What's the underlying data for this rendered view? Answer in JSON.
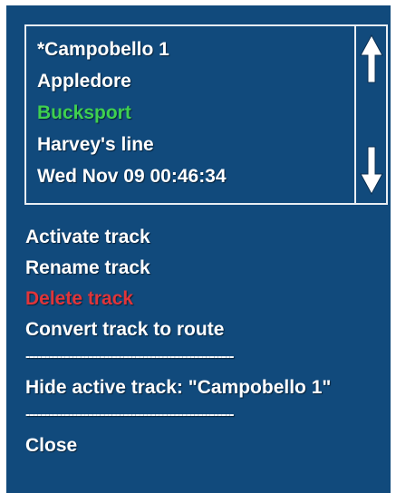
{
  "colors": {
    "panel_bg": "#114a7c",
    "text_default": "#ffffff",
    "text_selected": "#3fd04f",
    "text_destructive": "#e0353a",
    "border": "#e9eef3"
  },
  "track_list": {
    "items": [
      {
        "label": "*Campobello 1",
        "state": "default"
      },
      {
        "label": "Appledore",
        "state": "default"
      },
      {
        "label": "Bucksport",
        "state": "selected"
      },
      {
        "label": "Harvey's line",
        "state": "default"
      },
      {
        "label": "Wed Nov 09 00:46:34",
        "state": "default"
      }
    ],
    "scroll_up_icon": "arrow-up-icon",
    "scroll_down_icon": "arrow-down-icon"
  },
  "menu": {
    "activate_label": "Activate track",
    "rename_label": "Rename track",
    "delete_label": "Delete track",
    "convert_label": "Convert track to route",
    "separator_1": "-----------------------------------------------------",
    "hide_active_label": "Hide active track: \"Campobello 1\"",
    "separator_2": "-----------------------------------------------------",
    "close_label": "Close"
  }
}
